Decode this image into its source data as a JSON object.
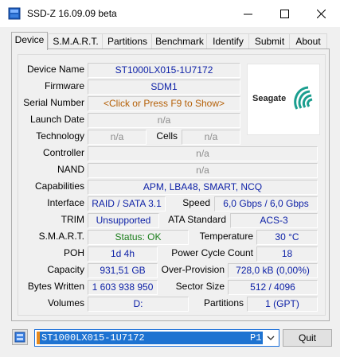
{
  "window": {
    "title": "SSD-Z 16.09.09 beta"
  },
  "tabs": [
    "Device",
    "S.M.A.R.T.",
    "Partitions",
    "Benchmark",
    "Identify",
    "Submit",
    "About"
  ],
  "device": {
    "device_name": {
      "label": "Device Name",
      "value": "ST1000LX015-1U7172"
    },
    "firmware": {
      "label": "Firmware",
      "value": "SDM1"
    },
    "serial_number": {
      "label": "Serial Number",
      "value": "<Click or Press F9 to Show>"
    },
    "launch_date": {
      "label": "Launch Date",
      "value": "n/a"
    },
    "technology": {
      "label": "Technology",
      "value": "n/a"
    },
    "cells": {
      "label": "Cells",
      "value": "n/a"
    },
    "controller": {
      "label": "Controller",
      "value": "n/a"
    },
    "nand": {
      "label": "NAND",
      "value": "n/a"
    },
    "capabilities": {
      "label": "Capabilities",
      "value": "APM, LBA48, SMART, NCQ"
    },
    "interface": {
      "label": "Interface",
      "value": "RAID / SATA 3.1"
    },
    "speed": {
      "label": "Speed",
      "value": "6,0 Gbps / 6,0 Gbps"
    },
    "trim": {
      "label": "TRIM",
      "value": "Unsupported"
    },
    "ata_standard": {
      "label": "ATA Standard",
      "value": "ACS-3"
    },
    "smart": {
      "label": "S.M.A.R.T.",
      "value": "Status: OK"
    },
    "temperature": {
      "label": "Temperature",
      "value": "30 °C"
    },
    "poh": {
      "label": "POH",
      "value": "1d 4h"
    },
    "power_cycle_count": {
      "label": "Power Cycle Count",
      "value": "18"
    },
    "capacity": {
      "label": "Capacity",
      "value": "931,51 GB"
    },
    "over_provision": {
      "label": "Over-Provision",
      "value": "728,0 kB (0,00%)"
    },
    "bytes_written": {
      "label": "Bytes Written",
      "value": "1 603 938 950"
    },
    "sector_size": {
      "label": "Sector Size",
      "value": "512 / 4096"
    },
    "volumes": {
      "label": "Volumes",
      "value": "D:"
    },
    "partitions": {
      "label": "Partitions",
      "value": "1 (GPT)"
    }
  },
  "logo": {
    "text": "Seagate"
  },
  "drive_selector": {
    "value": "ST1000LX015-1U7172",
    "tag": "P1"
  },
  "quit_label": "Quit",
  "colors": {
    "value_blue": "#0b1fa6",
    "na_gray": "#8c8c8c",
    "ok_green": "#1a7d1a",
    "serial_orange": "#b45f06",
    "selection_blue": "#1e73d1"
  },
  "icons": [
    "ssdz-app-icon",
    "minimize-icon",
    "maximize-icon",
    "close-icon",
    "refresh-icon",
    "chevron-down-icon",
    "seagate-logo"
  ]
}
